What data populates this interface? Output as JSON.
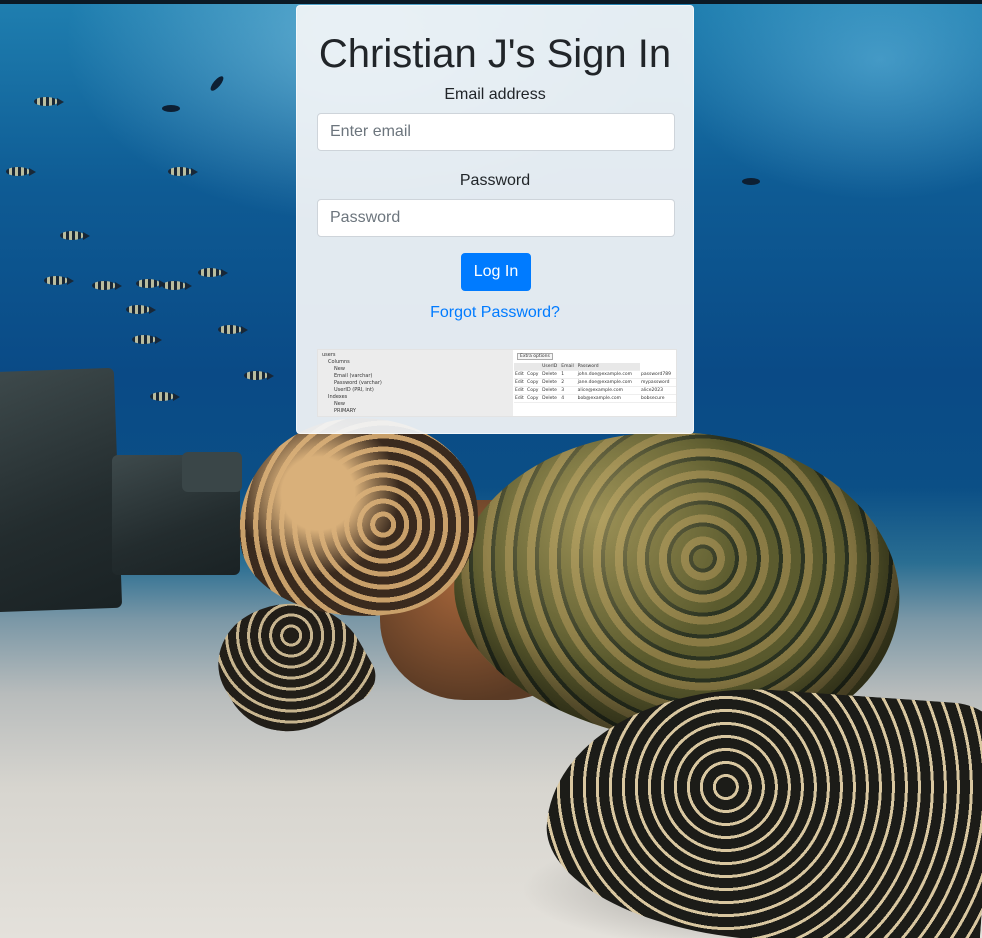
{
  "page": {
    "title": "Christian J's Sign In",
    "email_label": "Email address",
    "email_placeholder": "Enter email",
    "password_label": "Password",
    "password_placeholder": "Password",
    "login_button": "Log In",
    "forgot_link": "Forgot Password?"
  },
  "thumbnail": {
    "tree": [
      "users",
      "Columns",
      "New",
      "Email (varchar)",
      "Password (varchar)",
      "UserID (PRI, int)",
      "Indexes",
      "New",
      "PRIMARY"
    ],
    "grid_option": "Extra options",
    "grid_header": [
      "",
      "",
      "UserID",
      "Email",
      "Password"
    ],
    "rows": [
      [
        "Edit",
        "Copy",
        "Delete",
        "1",
        "john.doe@example.com",
        "password789"
      ],
      [
        "Edit",
        "Copy",
        "Delete",
        "2",
        "jane.doe@example.com",
        "mypassword"
      ],
      [
        "Edit",
        "Copy",
        "Delete",
        "3",
        "alice@example.com",
        "alice2023"
      ],
      [
        "Edit",
        "Copy",
        "Delete",
        "4",
        "bob@example.com",
        "bobsecure"
      ]
    ]
  },
  "colors": {
    "primary": "#007bff",
    "card_bg": "#f3f5f8",
    "text": "#212529"
  },
  "background": {
    "description_icon": "sea-turtle-underwater-photo"
  }
}
